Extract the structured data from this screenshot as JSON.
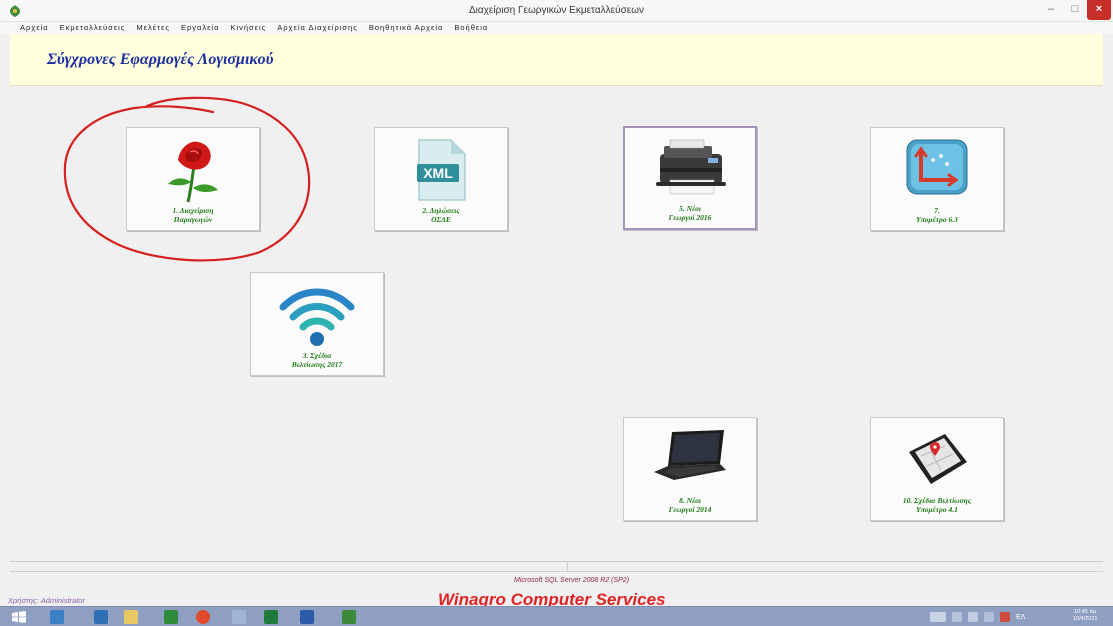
{
  "window": {
    "title": "Διαχείριση Γεωργικών Εκμεταλλεύσεων",
    "minimize_glyph": "–",
    "maximize_glyph": "□",
    "close_glyph": "×"
  },
  "menu": [
    "Αρχεία",
    "Εκμεταλλεύσεις",
    "Μελέτες",
    "Εργαλεία",
    "Κινήσεις",
    "Αρχεία Διαχείρισης",
    "Βοηθητικά Αρχεία",
    "Βοήθεια"
  ],
  "header": {
    "title": "Σύγχρονες Εφαρμογές Λογισμικού"
  },
  "tiles": {
    "t1": {
      "line1": "1. Διαχείριση",
      "line2": "Παραγωγών",
      "icon": "rose-icon"
    },
    "t2": {
      "line1": "2. Δηλώσεις",
      "line2": "ΟΣΔΕ",
      "icon": "xml-file-icon",
      "icon_text": "XML"
    },
    "t5": {
      "line1": "5. Νέοι",
      "line2": "Γεωργοί 2016",
      "icon": "printer-icon"
    },
    "t7": {
      "line1": "7.",
      "line2": "Υπομέτρο 6.3",
      "icon": "chart-axis-icon"
    },
    "t3": {
      "line1": "3. Σχέδια",
      "line2": "Βελτίωσης 2017",
      "icon": "wifi-icon"
    },
    "t8": {
      "line1": "8. Νέοι",
      "line2": "Γεωργοί 2014",
      "icon": "laptop-icon"
    },
    "t10": {
      "line1": "10. Σχέδια Βελτίωσης",
      "line2": "Υπομέτρο 4.1",
      "icon": "gps-phone-icon"
    }
  },
  "footer": {
    "user": "Χρήστης: Administrator",
    "sql": "Microsoft SQL Server 2008 R2 (SP2)",
    "brand": "Winagro Computer Services"
  },
  "taskbar": {
    "lang": "ΕΛ",
    "time": "10:45 πμ",
    "date": "10/4/2021"
  },
  "colors": {
    "header_band": "#ffffde",
    "title_blue": "#1b2ea0",
    "label_green": "#1f7a14",
    "brand_red": "#e02424",
    "taskbar": "#8f9fc2"
  }
}
